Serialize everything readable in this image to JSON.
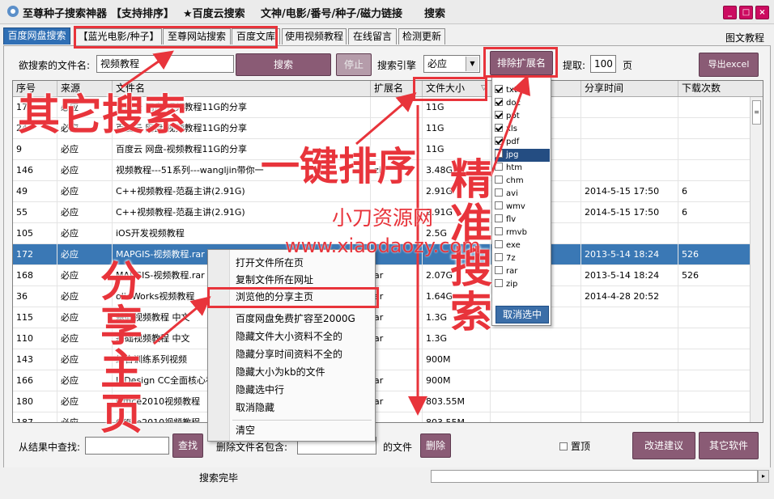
{
  "titlebar": {
    "items": [
      "至尊种子搜索神器",
      "【支持排序】",
      "★百度云搜索",
      "文神/电影/番号/种子/磁力链接",
      "搜索"
    ],
    "minimize": "_",
    "maximize": "□",
    "close": "×"
  },
  "tabs": [
    "百度网盘搜索",
    "【蓝光电影/种子】",
    "至尊网站搜索",
    "百度文库",
    "使用视频教程",
    "在线留言",
    "检测更新"
  ],
  "graphic_tutorial": "图文教程",
  "search": {
    "filename_label": "欲搜索的文件名:",
    "filename_value": "视频教程",
    "search_button": "搜索",
    "stop_button": "停止",
    "engine_label": "搜索引擎",
    "engine_value": "必应",
    "exclude_ext_button": "排除扩展名",
    "take_label": "提取:",
    "take_value": "100",
    "page_label": "页",
    "export_button": "导出excel"
  },
  "table": {
    "headers": [
      "序号",
      "来源",
      "文件名",
      "扩展名",
      "文件大小",
      "分享时间",
      "下载次数"
    ],
    "sort_indicator": "▽",
    "rows": [
      {
        "id": "17",
        "src": "必应",
        "name": "百度云 网盘-视频教程11G的分享",
        "ext": "",
        "size": "11G",
        "time": "",
        "dl": ""
      },
      {
        "id": "24",
        "src": "必应",
        "name": "百度云 网盘-视频教程11G的分享",
        "ext": "",
        "size": "11G",
        "time": "",
        "dl": ""
      },
      {
        "id": "9",
        "src": "必应",
        "name": "百度云 网盘-视频教程11G的分享",
        "ext": "",
        "size": "11G",
        "time": "",
        "dl": ""
      },
      {
        "id": "146",
        "src": "必应",
        "name": "视频教程---51系列---wangljin带你一",
        "ext": "zi",
        "size": "3.48G",
        "time": "",
        "dl": ""
      },
      {
        "id": "49",
        "src": "必应",
        "name": "C++视频教程-范磊主讲(2.91G)",
        "ext": "",
        "size": "2.91G",
        "time": "2014-5-15 17:50",
        "dl": "6"
      },
      {
        "id": "55",
        "src": "必应",
        "name": "C++视频教程-范磊主讲(2.91G)",
        "ext": "",
        "size": "2.91G",
        "time": "2014-5-15 17:50",
        "dl": "6"
      },
      {
        "id": "105",
        "src": "必应",
        "name": "iOS开发视频教程",
        "ext": "",
        "size": "2.5G",
        "time": "",
        "dl": ""
      },
      {
        "id": "172",
        "src": "必应",
        "name": "MAPGIS-视频教程.rar",
        "ext": "",
        "size": "",
        "time": "2013-5-14 18:24",
        "dl": "526"
      },
      {
        "id": "168",
        "src": "必应",
        "name": "MAPGIS-视频教程.rar",
        "ext": "ar",
        "size": "2.07G",
        "time": "2013-5-14 18:24",
        "dl": "526"
      },
      {
        "id": "36",
        "src": "必应",
        "name": "olidWorks视频教程",
        "ext": "ar",
        "size": "1.64G",
        "time": "2014-4-28 20:52",
        "dl": ""
      },
      {
        "id": "115",
        "src": "必应",
        "name": "基础视频教程 中文",
        "ext": "ar",
        "size": "1.3G",
        "time": "",
        "dl": ""
      },
      {
        "id": "110",
        "src": "必应",
        "name": "基础视频教程 中文",
        "ext": "ar",
        "size": "1.3G",
        "time": "",
        "dl": ""
      },
      {
        "id": "143",
        "src": "必应",
        "name": "综合训练系列视频",
        "ext": "",
        "size": "900M",
        "time": "",
        "dl": ""
      },
      {
        "id": "166",
        "src": "必应",
        "name": "InDesign CC全面核心视",
        "ext": "ar",
        "size": "900M",
        "time": "",
        "dl": ""
      },
      {
        "id": "180",
        "src": "必应",
        "name": "Office2010视频教程",
        "ext": "ar",
        "size": "803.55M",
        "time": "",
        "dl": ""
      },
      {
        "id": "187",
        "src": "必应",
        "name": "Office2010视频教程",
        "ext": "",
        "size": "803.55M",
        "time": "",
        "dl": ""
      }
    ]
  },
  "ext_menu": {
    "items": [
      {
        "label": "txt",
        "checked": true
      },
      {
        "label": "doc",
        "checked": true
      },
      {
        "label": "ppt",
        "checked": true
      },
      {
        "label": "xls",
        "checked": true
      },
      {
        "label": "pdf",
        "checked": true
      },
      {
        "label": "jpg",
        "checked": false
      },
      {
        "label": "htm",
        "checked": false
      },
      {
        "label": "chm",
        "checked": false
      },
      {
        "label": "avi",
        "checked": false
      },
      {
        "label": "wmv",
        "checked": false
      },
      {
        "label": "flv",
        "checked": false
      },
      {
        "label": "rmvb",
        "checked": false
      },
      {
        "label": "exe",
        "checked": false
      },
      {
        "label": "7z",
        "checked": false
      },
      {
        "label": "rar",
        "checked": false
      },
      {
        "label": "zip",
        "checked": false
      }
    ],
    "uncheck_button": "取消选中"
  },
  "context_menu": [
    "打开文件所在页",
    "复制文件所在网址",
    "浏览他的分享主页",
    "百度网盘免费扩容至2000G",
    "隐藏文件大小资料不全的",
    "隐藏分享时间资料不全的",
    "隐藏大小为kb的文件",
    "隐藏选中行",
    "取消隐藏",
    "清空"
  ],
  "bottom": {
    "find_label": "从结果中查找:",
    "find_button": "查找",
    "delete_label": "删除文件名包含:",
    "delete_suffix": "的文件",
    "delete_button": "删除",
    "top_label": "置顶",
    "suggest_button": "改进建议",
    "other_button": "其它软件",
    "status": "搜索完毕"
  },
  "annotations": {
    "other_search": "其它搜索",
    "one_click_sort": "一键排序",
    "precise_search": "精准搜索",
    "share_home": "分享主页",
    "watermark_cn": "小刀资源网",
    "watermark_url": "www.xiaodaozy.com"
  },
  "colors": {
    "accent": "#e8343b",
    "button": "#8a5b75",
    "selected": "#3a78b5",
    "window_button": "#cc0b60"
  }
}
